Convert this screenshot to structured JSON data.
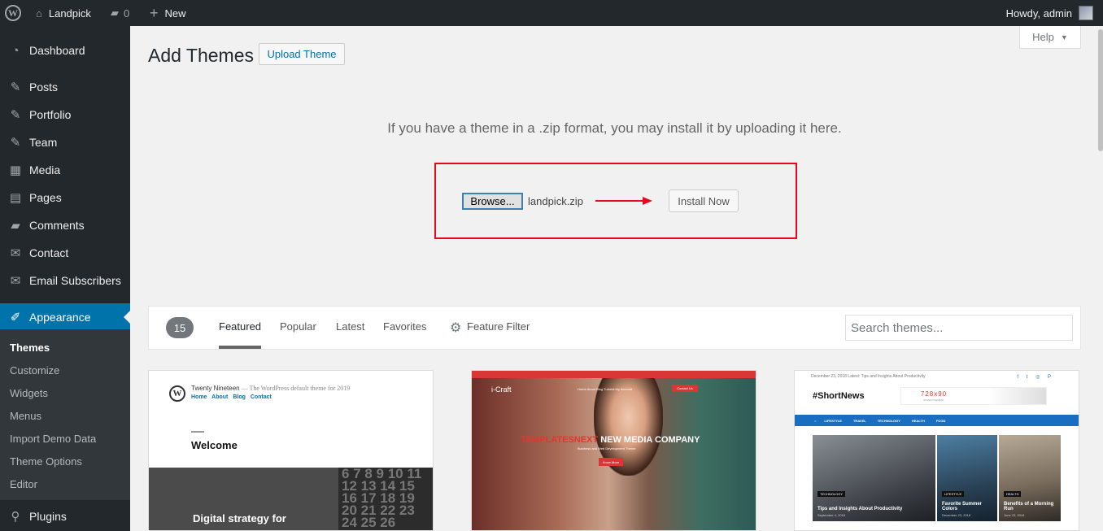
{
  "adminbar": {
    "site_name": "Landpick",
    "comments_count": "0",
    "new_label": "New",
    "howdy": "Howdy, admin"
  },
  "sidebar": {
    "items": [
      {
        "label": "Dashboard",
        "icon": "dashboard-icon"
      },
      {
        "label": "Posts",
        "icon": "pin-icon"
      },
      {
        "label": "Portfolio",
        "icon": "pin-icon"
      },
      {
        "label": "Team",
        "icon": "pin-icon"
      },
      {
        "label": "Media",
        "icon": "media-icon"
      },
      {
        "label": "Pages",
        "icon": "pages-icon"
      },
      {
        "label": "Comments",
        "icon": "comment-icon"
      },
      {
        "label": "Contact",
        "icon": "mail-icon"
      },
      {
        "label": "Email Subscribers",
        "icon": "mail-icon"
      },
      {
        "label": "Appearance",
        "icon": "brush-icon"
      },
      {
        "label": "Plugins",
        "icon": "plugin-icon"
      }
    ],
    "submenu": [
      "Themes",
      "Customize",
      "Widgets",
      "Menus",
      "Import Demo Data",
      "Theme Options",
      "Editor"
    ]
  },
  "header": {
    "title": "Add Themes",
    "upload_button": "Upload Theme",
    "help": "Help"
  },
  "upload": {
    "description": "If you have a theme in a .zip format, you may install it by uploading it here.",
    "browse_label": "Browse...",
    "filename": "landpick.zip",
    "install_label": "Install Now"
  },
  "filter": {
    "count": "15",
    "tabs": [
      "Featured",
      "Popular",
      "Latest",
      "Favorites"
    ],
    "feature_filter": "Feature Filter",
    "search_placeholder": "Search themes..."
  },
  "themes": [
    {
      "site_title": "Twenty Nineteen",
      "tagline": " — The WordPress default theme for 2019",
      "nav": [
        "Home",
        "About",
        "Blog",
        "Contact"
      ],
      "welcome": "Welcome",
      "calendar": "6 7 8 9 10 11 12 13 14 15 16 17 18 19 20 21 22 23 24 25 26",
      "headline": "Digital strategy for"
    },
    {
      "logo": "i-Craft",
      "nav": "Home   About   Blog   Tutorial   My Account",
      "contact": "Contact Us",
      "brand": "TEMPLATESNEXT",
      "title": " NEW MEDIA COMPANY",
      "subtitle": "Business and Web Development Theme",
      "button": "Know More"
    },
    {
      "topline": "December 23, 2018   Latest:  Tips and Insights About Productivity",
      "social": "f t ◎ P",
      "logo": "#ShortNews",
      "ad": "728x90",
      "ad_sub": "ADVERTISEMENT",
      "nav": [
        "LIFESTYLE",
        "TRAVEL",
        "TECHNOLOGY",
        "HEALTH",
        "FOOD"
      ],
      "posts": [
        {
          "tag": "TECHNOLOGY",
          "title": "Tips and Insights About Productivity",
          "date": "September 4, 2018"
        },
        {
          "tag": "LIFESTYLE",
          "title": "Favorite Summer Colors",
          "date": "December 23, 2018"
        },
        {
          "tag": "HEALTH",
          "title": "Benefits of a Morning Run",
          "date": "June 23, 2018"
        }
      ]
    }
  ],
  "colors": {
    "adminbar_bg": "#23282d",
    "accent": "#0073aa",
    "highlight_red": "#e5091e"
  }
}
